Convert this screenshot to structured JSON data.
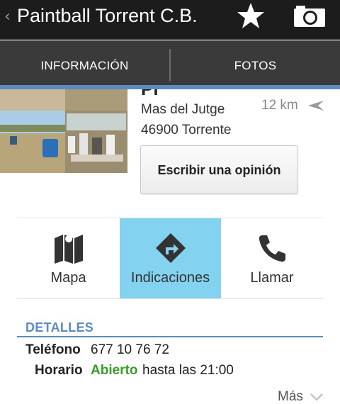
{
  "actionbar": {
    "title": "Paintball Torrent C.B.",
    "up_icon": "chevron-left-icon",
    "star_icon": "star-icon",
    "camera_icon": "camera-icon"
  },
  "tabs": [
    {
      "label": "INFORMACIÓN",
      "selected": true
    },
    {
      "label": "FOTOS",
      "selected": false
    }
  ],
  "place": {
    "name_fragment": "Pr",
    "address_line1": "Mas del Jutge",
    "address_line2": "46900 Torrente",
    "distance": "12 km",
    "distance_icon": "direction-arrow-icon"
  },
  "review_button": {
    "label": "Escribir una opinión"
  },
  "actions": [
    {
      "label": "Mapa",
      "icon": "map-icon",
      "highlighted": false
    },
    {
      "label": "Indicaciones",
      "icon": "directions-icon",
      "highlighted": true
    },
    {
      "label": "Llamar",
      "icon": "phone-icon",
      "highlighted": false
    }
  ],
  "details": {
    "title": "DETALLES",
    "phone_label": "Teléfono",
    "phone_value": "677 10 76 72",
    "hours_label": "Horario",
    "hours_status": "Abierto",
    "hours_rest": "hasta las 21:00",
    "more_label": "Más"
  },
  "colors": {
    "actionbar_bg": "#1c1c1c",
    "tabbar_bg": "#3a3a3a",
    "accent": "#5e8ac2",
    "highlight": "#83d3f0",
    "open_status": "#3c9a2e"
  }
}
